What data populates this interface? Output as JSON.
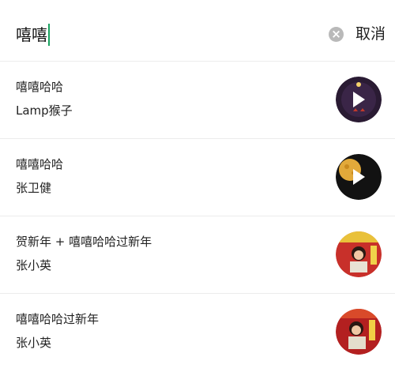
{
  "search": {
    "query": "嘻嘻",
    "cancel_label": "取消",
    "clear_icon": "clear-circle-icon"
  },
  "results": [
    {
      "title": "嘻嘻哈哈",
      "artist": "Lamp猴子",
      "cover_color": "#2a1b33"
    },
    {
      "title": "嘻嘻哈哈",
      "artist": "张卫健",
      "cover_color": "#121212"
    },
    {
      "title": "贺新年 + 嘻嘻哈哈过新年",
      "artist": "张小英",
      "cover_color": "#c8302a"
    },
    {
      "title": "嘻嘻哈哈过新年",
      "artist": "张小英",
      "cover_color": "#b32020"
    }
  ]
}
